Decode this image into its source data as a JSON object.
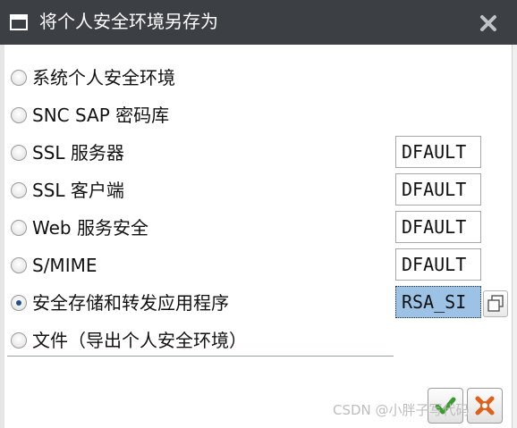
{
  "dialog": {
    "title": "将个人安全环境另存为"
  },
  "options": [
    {
      "label": "系统个人安全环境",
      "checked": false,
      "code": null
    },
    {
      "label": "SNC SAP 密码库",
      "checked": false,
      "code": null
    },
    {
      "label": "SSL 服务器",
      "checked": false,
      "code": "DFAULT"
    },
    {
      "label": "SSL 客户端",
      "checked": false,
      "code": "DFAULT"
    },
    {
      "label": "Web 服务安全",
      "checked": false,
      "code": "DFAULT"
    },
    {
      "label": "S/MIME",
      "checked": false,
      "code": "DFAULT"
    },
    {
      "label": "安全存储和转发应用程序",
      "checked": true,
      "code": "RSA_SI"
    },
    {
      "label": "文件（导出个人安全环境）",
      "checked": false,
      "code": null
    }
  ],
  "watermark": "CSDN @小胖子写代码",
  "icons": {
    "title": "save-as-icon",
    "close": "close-icon",
    "copy": "copy-icon",
    "confirm": "checkmark-icon",
    "cancel": "cancel-icon"
  },
  "colors": {
    "titlebar": "#3c3f44",
    "selected_field": "#9cc3e6",
    "confirm_green": "#3a9a2e",
    "cancel_orange": "#e0601a"
  }
}
